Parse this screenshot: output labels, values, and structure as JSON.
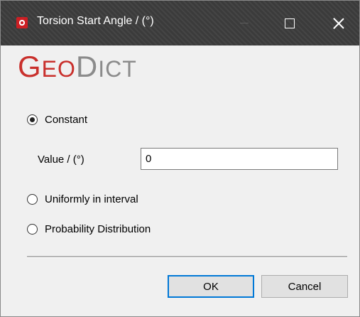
{
  "window": {
    "title": "Torsion Start Angle / (°)",
    "titlebar_color": "#3b3b3b",
    "icon": "geodict-app-icon",
    "controls": {
      "minimize_icon": "minimize-icon",
      "maximize_icon": "maximize-icon",
      "close_icon": "close-icon"
    }
  },
  "logo": {
    "part1_initial": "G",
    "part1_rest": "EO",
    "part2_initial": "D",
    "part2_rest": "ICT",
    "part1_color": "#c9302c",
    "part2_color": "#8b8b8b"
  },
  "options": {
    "constant": {
      "label": "Constant",
      "selected": true
    },
    "uniform": {
      "label": "Uniformly in interval",
      "selected": false
    },
    "probability": {
      "label": "Probability Distribution",
      "selected": false
    }
  },
  "value_field": {
    "label": "Value / (°)",
    "value": "0"
  },
  "buttons": {
    "ok": "OK",
    "cancel": "Cancel"
  },
  "colors": {
    "accent_focus": "#0078d7",
    "dialog_background": "#f0f0f0"
  }
}
